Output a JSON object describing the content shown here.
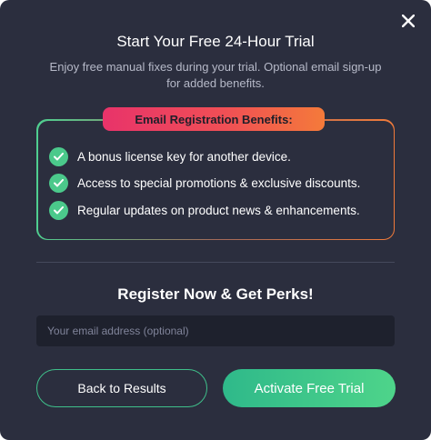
{
  "dialog": {
    "title": "Start Your Free 24-Hour Trial",
    "subtitle": "Enjoy free manual fixes during your trial. Optional email sign-up for added benefits.",
    "close_icon": "close-icon"
  },
  "benefits": {
    "badge": "Email Registration Benefits:",
    "items": [
      "A bonus license key for another device.",
      "Access to special promotions & exclusive discounts.",
      "Regular updates on product news & enhancements."
    ],
    "check_icon": "check-circle-icon"
  },
  "register": {
    "heading": "Register Now & Get Perks!",
    "email_placeholder": "Your email address (optional)",
    "email_value": ""
  },
  "actions": {
    "back_label": "Back to Results",
    "activate_label": "Activate Free Trial"
  },
  "colors": {
    "background": "#2b2e3e",
    "accent_green": "#4bc98b",
    "badge_gradient_start": "#e8336a",
    "badge_gradient_end": "#f47a3a",
    "input_background": "#1e212d"
  }
}
